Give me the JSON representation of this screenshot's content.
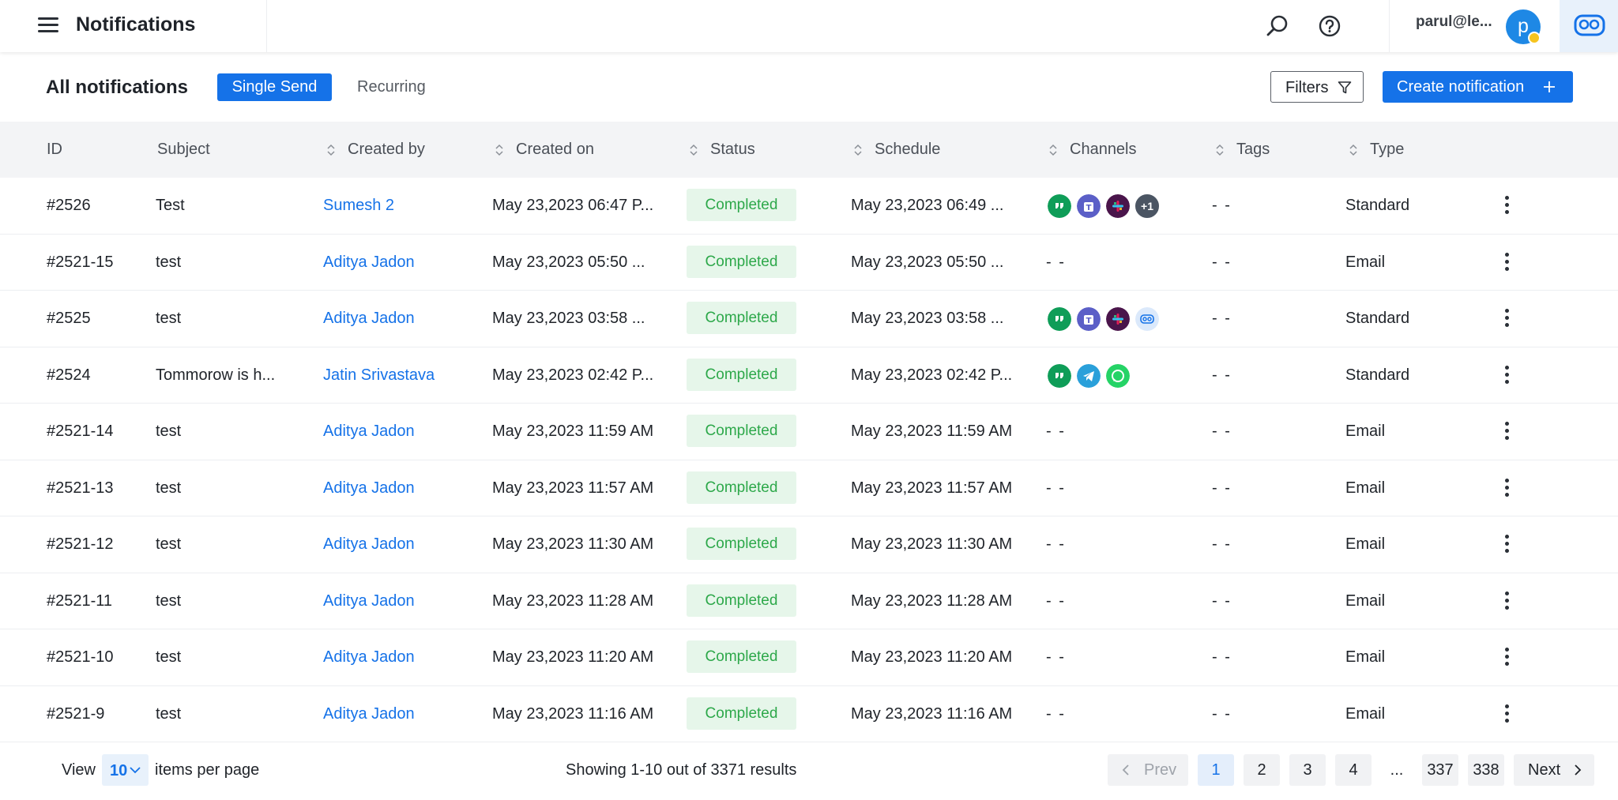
{
  "header": {
    "title": "Notifications",
    "user_email": "parul@le...",
    "avatar_initial": "p"
  },
  "subheader": {
    "heading": "All notifications",
    "tabs": [
      {
        "label": "Single Send",
        "active": true
      },
      {
        "label": "Recurring",
        "active": false
      }
    ],
    "filters_label": "Filters",
    "create_label": "Create notification"
  },
  "table": {
    "columns": [
      "ID",
      "Subject",
      "Created by",
      "Created on",
      "Status",
      "Schedule",
      "Channels",
      "Tags",
      "Type"
    ],
    "empty_marker": "- -",
    "rows": [
      {
        "id": "#2526",
        "subject": "Test",
        "created_by": "Sumesh 2",
        "created_on": "May 23,2023 06:47 P...",
        "status": "Completed",
        "schedule": "May 23,2023 06:49 ...",
        "channels": [
          "hangouts",
          "teams",
          "slack",
          "more"
        ],
        "more_count": "+1",
        "tags": "- -",
        "type": "Standard"
      },
      {
        "id": "#2521-15",
        "subject": "test",
        "created_by": "Aditya Jadon",
        "created_on": "May 23,2023 05:50 ...",
        "status": "Completed",
        "schedule": "May 23,2023 05:50 ...",
        "channels": [],
        "tags": "- -",
        "type": "Email"
      },
      {
        "id": "#2525",
        "subject": "test",
        "created_by": "Aditya Jadon",
        "created_on": "May 23,2023 03:58 ...",
        "status": "Completed",
        "schedule": "May 23,2023 03:58 ...",
        "channels": [
          "hangouts",
          "teams",
          "slack",
          "brand"
        ],
        "tags": "- -",
        "type": "Standard"
      },
      {
        "id": "#2524",
        "subject": "Tommorow is h...",
        "created_by": "Jatin Srivastava",
        "created_on": "May 23,2023 02:42 P...",
        "status": "Completed",
        "schedule": "May 23,2023 02:42 P...",
        "channels": [
          "hangouts",
          "telegram",
          "whatsapp"
        ],
        "tags": "- -",
        "type": "Standard"
      },
      {
        "id": "#2521-14",
        "subject": "test",
        "created_by": "Aditya Jadon",
        "created_on": "May 23,2023 11:59 AM",
        "status": "Completed",
        "schedule": "May 23,2023 11:59 AM",
        "channels": [],
        "tags": "- -",
        "type": "Email"
      },
      {
        "id": "#2521-13",
        "subject": "test",
        "created_by": "Aditya Jadon",
        "created_on": "May 23,2023 11:57 AM",
        "status": "Completed",
        "schedule": "May 23,2023 11:57 AM",
        "channels": [],
        "tags": "- -",
        "type": "Email"
      },
      {
        "id": "#2521-12",
        "subject": "test",
        "created_by": "Aditya Jadon",
        "created_on": "May 23,2023 11:30 AM",
        "status": "Completed",
        "schedule": "May 23,2023 11:30 AM",
        "channels": [],
        "tags": "- -",
        "type": "Email"
      },
      {
        "id": "#2521-11",
        "subject": "test",
        "created_by": "Aditya Jadon",
        "created_on": "May 23,2023 11:28 AM",
        "status": "Completed",
        "schedule": "May 23,2023 11:28 AM",
        "channels": [],
        "tags": "- -",
        "type": "Email"
      },
      {
        "id": "#2521-10",
        "subject": "test",
        "created_by": "Aditya Jadon",
        "created_on": "May 23,2023 11:20 AM",
        "status": "Completed",
        "schedule": "May 23,2023 11:20 AM",
        "channels": [],
        "tags": "- -",
        "type": "Email"
      },
      {
        "id": "#2521-9",
        "subject": "test",
        "created_by": "Aditya Jadon",
        "created_on": "May 23,2023 11:16 AM",
        "status": "Completed",
        "schedule": "May 23,2023 11:16 AM",
        "channels": [],
        "tags": "- -",
        "type": "Email"
      }
    ]
  },
  "footer": {
    "view_label": "View",
    "per_page": "10",
    "per_page_suffix": "items per page",
    "showing": "Showing 1-10 out of 3371 results",
    "prev_label": "Prev",
    "next_label": "Next",
    "pages": [
      "1",
      "2",
      "3",
      "4",
      "...",
      "337",
      "338"
    ],
    "current_page": "1"
  },
  "colors": {
    "accent": "#1572e8",
    "status_bg": "#e6f6ea",
    "status_text": "#2da84a",
    "link": "#1572e8"
  },
  "icons": {
    "menu": "hamburger-icon",
    "search": "search-icon",
    "help": "help-icon",
    "filter": "filter-funnel-icon",
    "add": "plus-icon",
    "sort": "sort-icon",
    "more": "kebab-menu-icon"
  }
}
